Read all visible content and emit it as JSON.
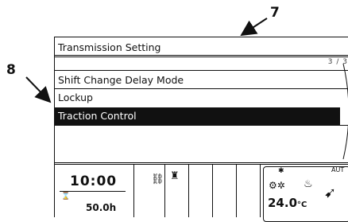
{
  "callouts": {
    "top": "7",
    "left": "8"
  },
  "screen": {
    "title": "Transmission Setting",
    "page_indicator": "3 / 3",
    "menu_items": [
      {
        "label": "Shift Change Delay Mode",
        "selected": false
      },
      {
        "label": "Lockup",
        "selected": false
      },
      {
        "label": "Traction Control",
        "selected": true
      }
    ]
  },
  "status": {
    "clock": "10:00",
    "hour_meter": "50.0h",
    "climate_temp": "24.0",
    "climate_unit": "°C",
    "climate_mode": "AUT"
  }
}
